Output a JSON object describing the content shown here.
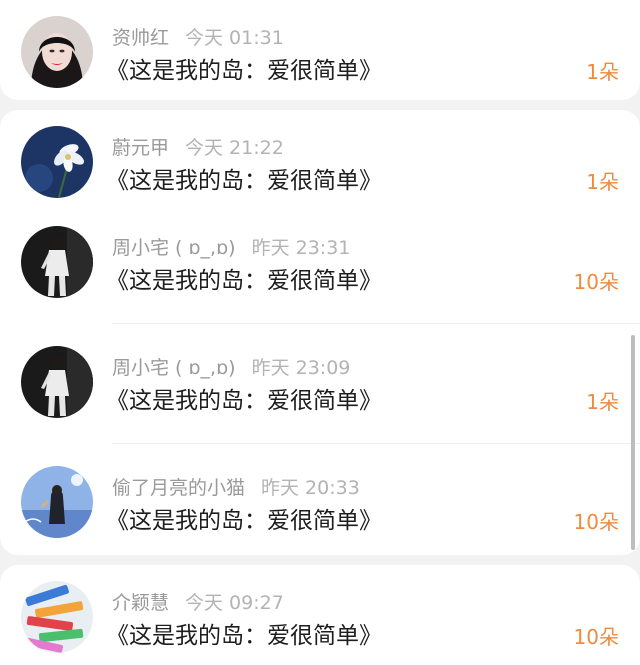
{
  "gifts": [
    {
      "user": "资帅红",
      "time": "今天 01:31",
      "message": "《这是我的岛：爱很简单》",
      "count": "1朵",
      "avatar_icon": "woman-portrait-avatar"
    },
    {
      "user": "蔚元甲",
      "time": "今天 21:22",
      "message": "《这是我的岛：爱很简单》",
      "count": "1朵",
      "avatar_icon": "white-flower-avatar"
    },
    {
      "user": "周小宅 ( ɒ_,ɒ)",
      "time": "昨天 23:31",
      "message": "《这是我的岛：爱很简单》",
      "count": "10朵",
      "avatar_icon": "person-white-outfit-avatar"
    },
    {
      "user": "周小宅 ( ɒ_,ɒ)",
      "time": "昨天 23:09",
      "message": "《这是我的岛：爱很简单》",
      "count": "1朵",
      "avatar_icon": "person-white-outfit-avatar"
    },
    {
      "user": "偷了月亮的小猫",
      "time": "昨天 20:33",
      "message": "《这是我的岛：爱很简单》",
      "count": "10朵",
      "avatar_icon": "girl-blue-sky-avatar"
    },
    {
      "user": "介颖慧",
      "time": "今天 09:27",
      "message": "《这是我的岛：爱很简单》",
      "count": "10朵",
      "avatar_icon": "colored-pencils-avatar"
    }
  ],
  "colors": {
    "count_accent": "#f08a3c",
    "meta_text": "#9a9a9a",
    "message_text": "#1e1e1e",
    "card_background": "#ffffff",
    "page_background": "#f2f2f2"
  }
}
